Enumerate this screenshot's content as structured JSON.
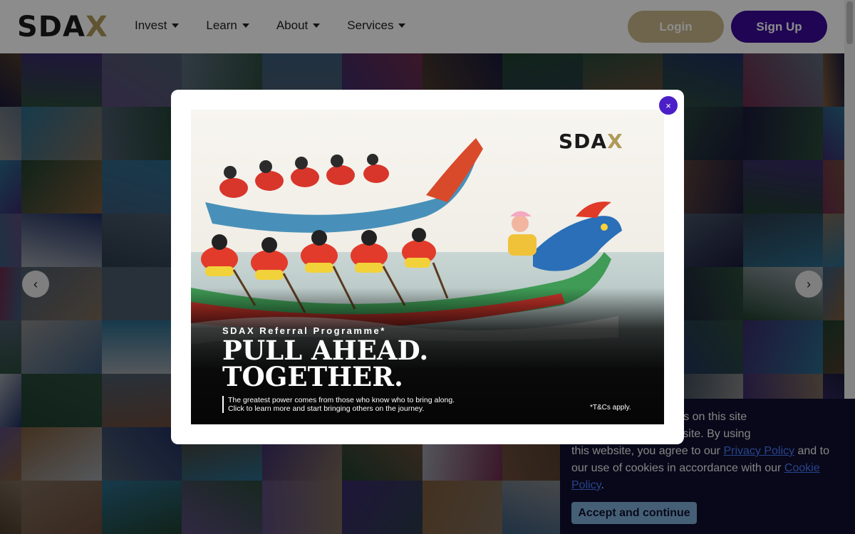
{
  "header": {
    "logo": {
      "main": "SDA",
      "x": "X"
    },
    "nav": [
      {
        "label": "Invest"
      },
      {
        "label": "Learn"
      },
      {
        "label": "About"
      },
      {
        "label": "Services"
      }
    ],
    "login_label": "Login",
    "signup_label": "Sign Up"
  },
  "colors": {
    "brand_purple": "#3a0a9a",
    "login_gold": "#c9b98a",
    "close_button": "#4a1fc8",
    "cookie_bg": "#101030",
    "cookie_link": "#4a7dff",
    "cookie_button": "#7fb0d8"
  },
  "carousel": {
    "prev_icon": "chevron-left-icon",
    "next_icon": "chevron-right-icon",
    "prev_glyph": "‹",
    "next_glyph": "›"
  },
  "modal": {
    "close_icon": "close-icon",
    "close_glyph": "×",
    "banner": {
      "logo_main": "SDA",
      "logo_x": "X",
      "kicker": "SDAX Referral Programme*",
      "headline_line1": "PULL AHEAD.",
      "headline_line2": "TOGETHER.",
      "sub_line1": "The greatest power comes from those who know who to bring along.",
      "sub_line2": "Click to learn more and start bringing others on the journey.",
      "tnc": "*T&Cs apply."
    }
  },
  "cookie": {
    "text_before": "related technologies on this site",
    "text_mid1": "experience on this site. By using",
    "text_mid2": "this website, you agree to our ",
    "privacy_link": "Privacy Policy",
    "text_mid3": " and to our use of cookies in accordance with our ",
    "cookie_link": "Cookie Policy",
    "text_end": ".",
    "accept_label": "Accept and continue"
  }
}
